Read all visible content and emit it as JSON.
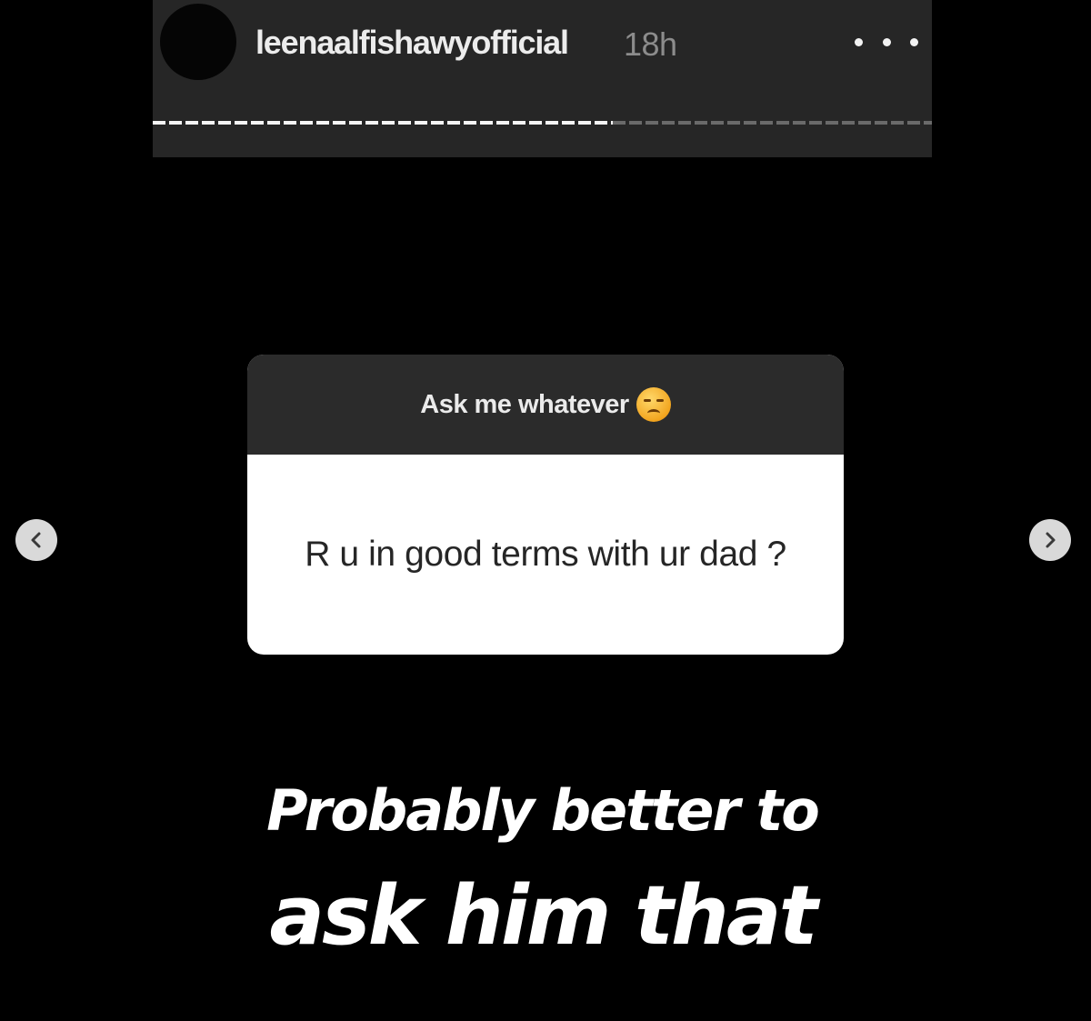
{
  "story": {
    "username": "leenaalfishawyofficial",
    "timestamp": "18h",
    "more_icon": "more-horizontal-icon",
    "progress": {
      "completed_fraction": 0.59
    }
  },
  "navigation": {
    "prev_icon": "chevron-left-icon",
    "next_icon": "chevron-right-icon"
  },
  "question_sticker": {
    "prompt": "Ask me whatever",
    "prompt_emoji": "emoji-face-icon",
    "question": "R u in good terms with ur dad ?"
  },
  "answer": {
    "line1": "Probably better to",
    "line2": "ask him that"
  },
  "colors": {
    "background": "#000000",
    "header_bg": "#262626",
    "card_header_bg": "#2b2b2b",
    "card_body_bg": "#ffffff",
    "text_light": "#ffffff"
  }
}
